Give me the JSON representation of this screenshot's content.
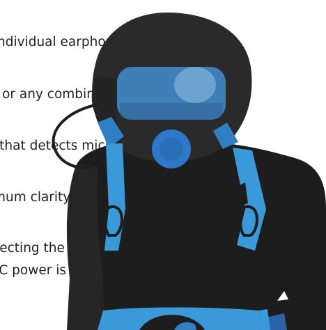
{
  "text_lines": [
    "ndividual earphone and",
    ") or any combination of the two",
    "t that detects microphone type",
    "mum clarity, see Tech Note",
    "tecting the rechargeable battery",
    "AC power is disconnected to allow"
  ],
  "colors": {
    "suit": "#1d1d1d",
    "helmet": "#2a2a2a",
    "visor": "#3f7fb7",
    "visor_highlight": "#6ea3cf",
    "light_blue": "#3a9ad9",
    "blue": "#2f7fc5",
    "text": "#222222"
  }
}
